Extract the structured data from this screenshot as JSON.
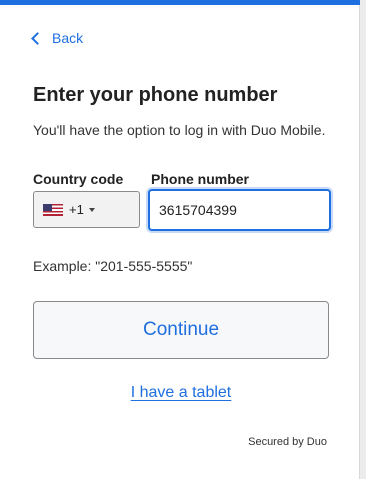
{
  "nav": {
    "back_label": "Back"
  },
  "page": {
    "title": "Enter your phone number",
    "subtitle": "You'll have the option to log in with Duo Mobile."
  },
  "form": {
    "country_label": "Country code",
    "country_code": "+1",
    "country_flag": "us-flag-icon",
    "phone_label": "Phone number",
    "phone_value": "3615704399",
    "example": "Example: \"201-555-5555\""
  },
  "actions": {
    "continue_label": "Continue",
    "tablet_label": "I have a tablet"
  },
  "footer": {
    "secured_label": "Secured by Duo"
  },
  "colors": {
    "accent": "#1f6fe0",
    "text": "#222222",
    "button_bg": "#f7f8fa"
  }
}
